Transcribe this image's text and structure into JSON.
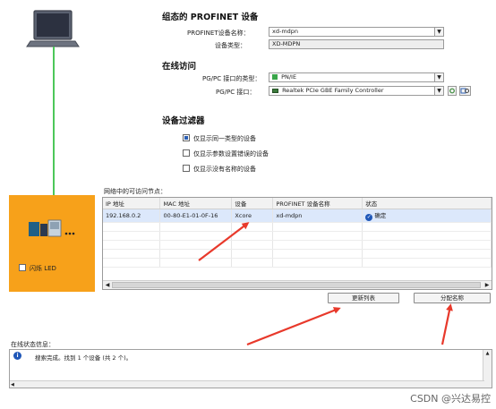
{
  "config": {
    "title": "组态的 PROFINET 设备",
    "device_name_label": "PROFINET设备名称：",
    "device_name_value": "xd-mdpn",
    "device_type_label": "设备类型：",
    "device_type_value": "XD-MDPN"
  },
  "online": {
    "title": "在线访问",
    "iface_type_label": "PG/PC 接口的类型：",
    "iface_type_value": "PN/IE",
    "iface_label": "PG/PC 接口：",
    "iface_value": "Realtek PCIe GBE Family Controller"
  },
  "filter": {
    "title": "设备过滤器",
    "options": [
      {
        "label": "仅显示同一类型的设备",
        "checked": true
      },
      {
        "label": "仅显示参数设置错误的设备",
        "checked": false
      },
      {
        "label": "仅显示没有名称的设备",
        "checked": false
      }
    ]
  },
  "nodes": {
    "caption": "网络中的可访问节点：",
    "columns": [
      "IP 地址",
      "MAC 地址",
      "设备",
      "PROFINET 设备名称",
      "状态"
    ],
    "rows": [
      {
        "ip": "192.168.0.2",
        "mac": "00-80-E1-01-0F-16",
        "device": "Xcore",
        "name": "xd-mdpn",
        "status": "确定"
      }
    ]
  },
  "device_panel": {
    "led_label": "闪烁 LED"
  },
  "buttons": {
    "refresh": "更新列表",
    "assign": "分配名称"
  },
  "status": {
    "caption": "在线状态信息：",
    "message": "搜索完成。找到 1 个设备 (共 2 个)。"
  },
  "watermark": "CSDN @兴达易控",
  "colors": {
    "device_panel": "#f7a11a",
    "cable": "#4cc75a",
    "arrow": "#e8392b",
    "selection": "#dce8fb"
  }
}
